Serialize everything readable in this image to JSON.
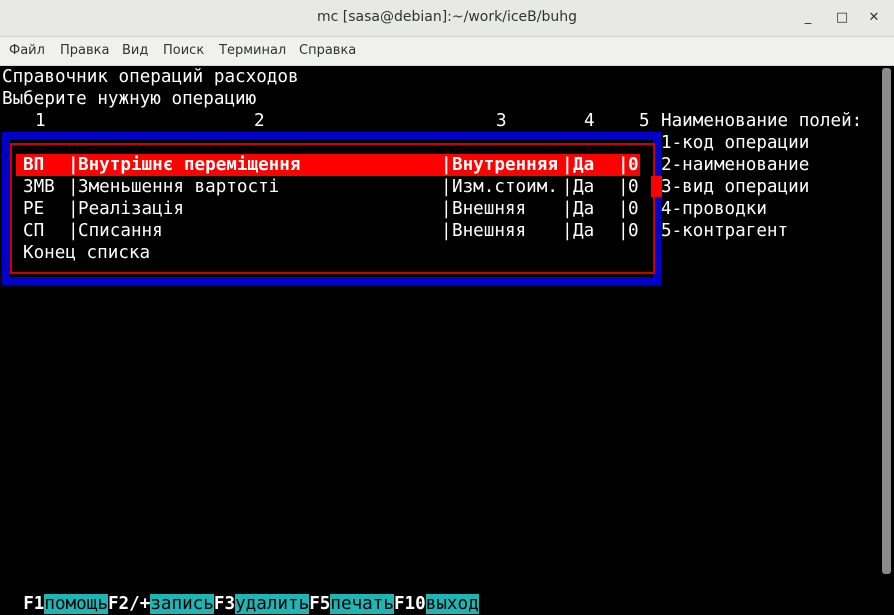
{
  "window": {
    "title": "mc [sasa@debian]:~/work/iceB/buhg",
    "buttons": {
      "minimize": "_",
      "maximize": "□",
      "close": "✕"
    }
  },
  "menubar": [
    "Файл",
    "Правка",
    "Вид",
    "Поиск",
    "Терминал",
    "Справка"
  ],
  "terminal": {
    "header1": "Справочник операций расходов",
    "header2": "Выберите нужную операцию",
    "col_numbers": [
      "1",
      "2",
      "3",
      "4",
      "5"
    ],
    "field_names_title": "Наименование полей:",
    "field_names": [
      "1-код операции",
      "2-наименование",
      "3-вид операции",
      "4-проводки",
      "5-контрагент"
    ],
    "list": {
      "rows": [
        {
          "code": "ВП",
          "name": "Внутрішнє переміщення",
          "type": "Внутренняя",
          "post": "Да",
          "cp": "0",
          "selected": true
        },
        {
          "code": "ЗМВ",
          "name": "Зменьшення вартості",
          "type": "Изм.стоим.",
          "post": "Да",
          "cp": "0",
          "selected": false
        },
        {
          "code": "РЕ",
          "name": "Реалізація",
          "type": "Внешняя",
          "post": "Да",
          "cp": "0",
          "selected": false
        },
        {
          "code": "СП",
          "name": "Списання",
          "type": "Внешняя",
          "post": "Да",
          "cp": "0",
          "selected": false
        }
      ],
      "end_label": "Конец списка",
      "separator": "|"
    },
    "fkeys": [
      {
        "key": "F1",
        "label": "помощь"
      },
      {
        "key": "F2/+",
        "label": "запись"
      },
      {
        "key": "F3",
        "label": "удалить"
      },
      {
        "key": "F5",
        "label": "печать"
      },
      {
        "key": "F10",
        "label": "выход"
      }
    ]
  },
  "colors": {
    "frame_blue": "#0000c8",
    "select_red": "#ff0000",
    "fkey_label_bg": "#1fb5b5"
  }
}
